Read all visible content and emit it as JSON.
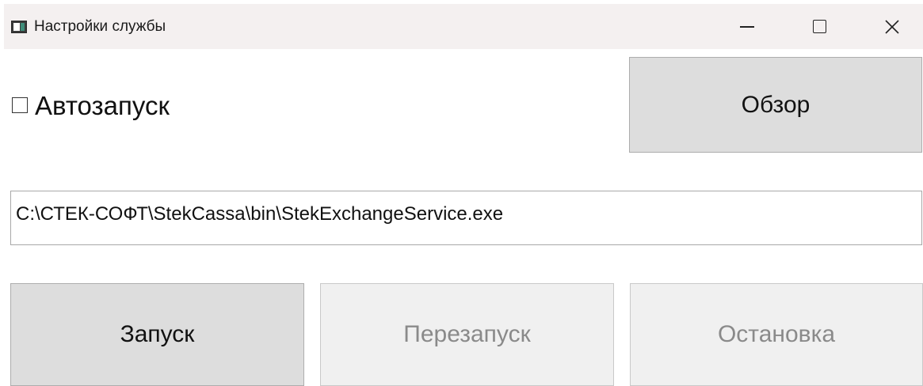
{
  "window": {
    "title": "Настройки службы",
    "icon": "app-window-icon",
    "controls": {
      "minimize_icon": "minimize-icon",
      "maximize_icon": "maximize-icon",
      "close_icon": "close-icon"
    }
  },
  "autostart": {
    "label": "Автозапуск",
    "checked": false
  },
  "browse_button": {
    "label": "Обзор"
  },
  "path_field": {
    "value": "C:\\СТЕК-СОФТ\\StekCassa\\bin\\StekExchangeService.exe"
  },
  "service_buttons": {
    "start": {
      "label": "Запуск",
      "enabled": true
    },
    "restart": {
      "label": "Перезапуск",
      "enabled": false
    },
    "stop": {
      "label": "Остановка",
      "enabled": false
    }
  },
  "colors": {
    "titlebar_bg": "#f4f0f0",
    "button_bg": "#dddddd",
    "button_disabled_bg": "#f0f0f0",
    "disabled_text": "#8a8a8a"
  }
}
